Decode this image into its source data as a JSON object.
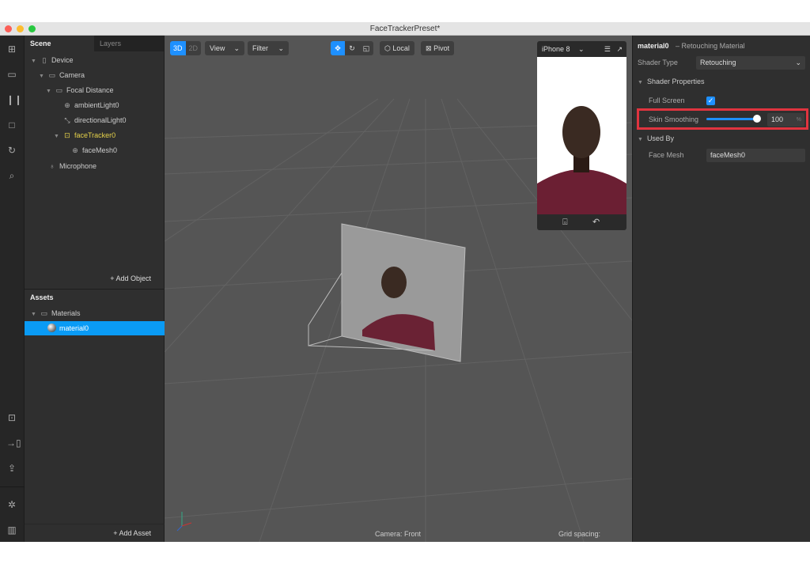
{
  "window": {
    "title": "FaceTrackerPreset*"
  },
  "scene_panel": {
    "tabs": [
      {
        "label": "Scene"
      },
      {
        "label": "Layers"
      }
    ],
    "items": [
      {
        "label": "Device",
        "icon": "phone-icon"
      },
      {
        "label": "Camera",
        "icon": "camera-icon"
      },
      {
        "label": "Focal Distance",
        "icon": "ruler-icon"
      },
      {
        "label": "ambientLight0",
        "icon": "globe-icon"
      },
      {
        "label": "directionalLight0",
        "icon": "directional-light-icon"
      },
      {
        "label": "faceTracker0",
        "icon": "face-tracker-icon"
      },
      {
        "label": "faceMesh0",
        "icon": "globe-icon"
      },
      {
        "label": "Microphone",
        "icon": "microphone-icon"
      }
    ],
    "add_object": "+ Add Object"
  },
  "assets_panel": {
    "title": "Assets",
    "folder": "Materials",
    "selected": "material0",
    "add_asset": "+ Add Asset"
  },
  "toolbar": {
    "mode_3d": "3D",
    "mode_2d": "2D",
    "view": "View",
    "filter": "Filter",
    "local": "Local",
    "pivot": "Pivot",
    "accent": "#1e90ff"
  },
  "preview": {
    "device": "iPhone 8"
  },
  "viewport": {
    "camera_label": "Camera: Front",
    "grid_spacing": "Grid spacing:"
  },
  "inspector": {
    "name": "material0",
    "subtitle": "– Retouching Material",
    "shader_type_label": "Shader Type",
    "shader_type_value": "Retouching",
    "shader_props": "Shader Properties",
    "full_screen_label": "Full Screen",
    "full_screen_checked": true,
    "skin_smoothing_label": "Skin Smoothing",
    "skin_smoothing_value": "100",
    "skin_smoothing_unit": "%",
    "used_by": "Used By",
    "face_mesh_label": "Face Mesh",
    "face_mesh_value": "faceMesh0",
    "highlight_color": "#e0343f"
  }
}
